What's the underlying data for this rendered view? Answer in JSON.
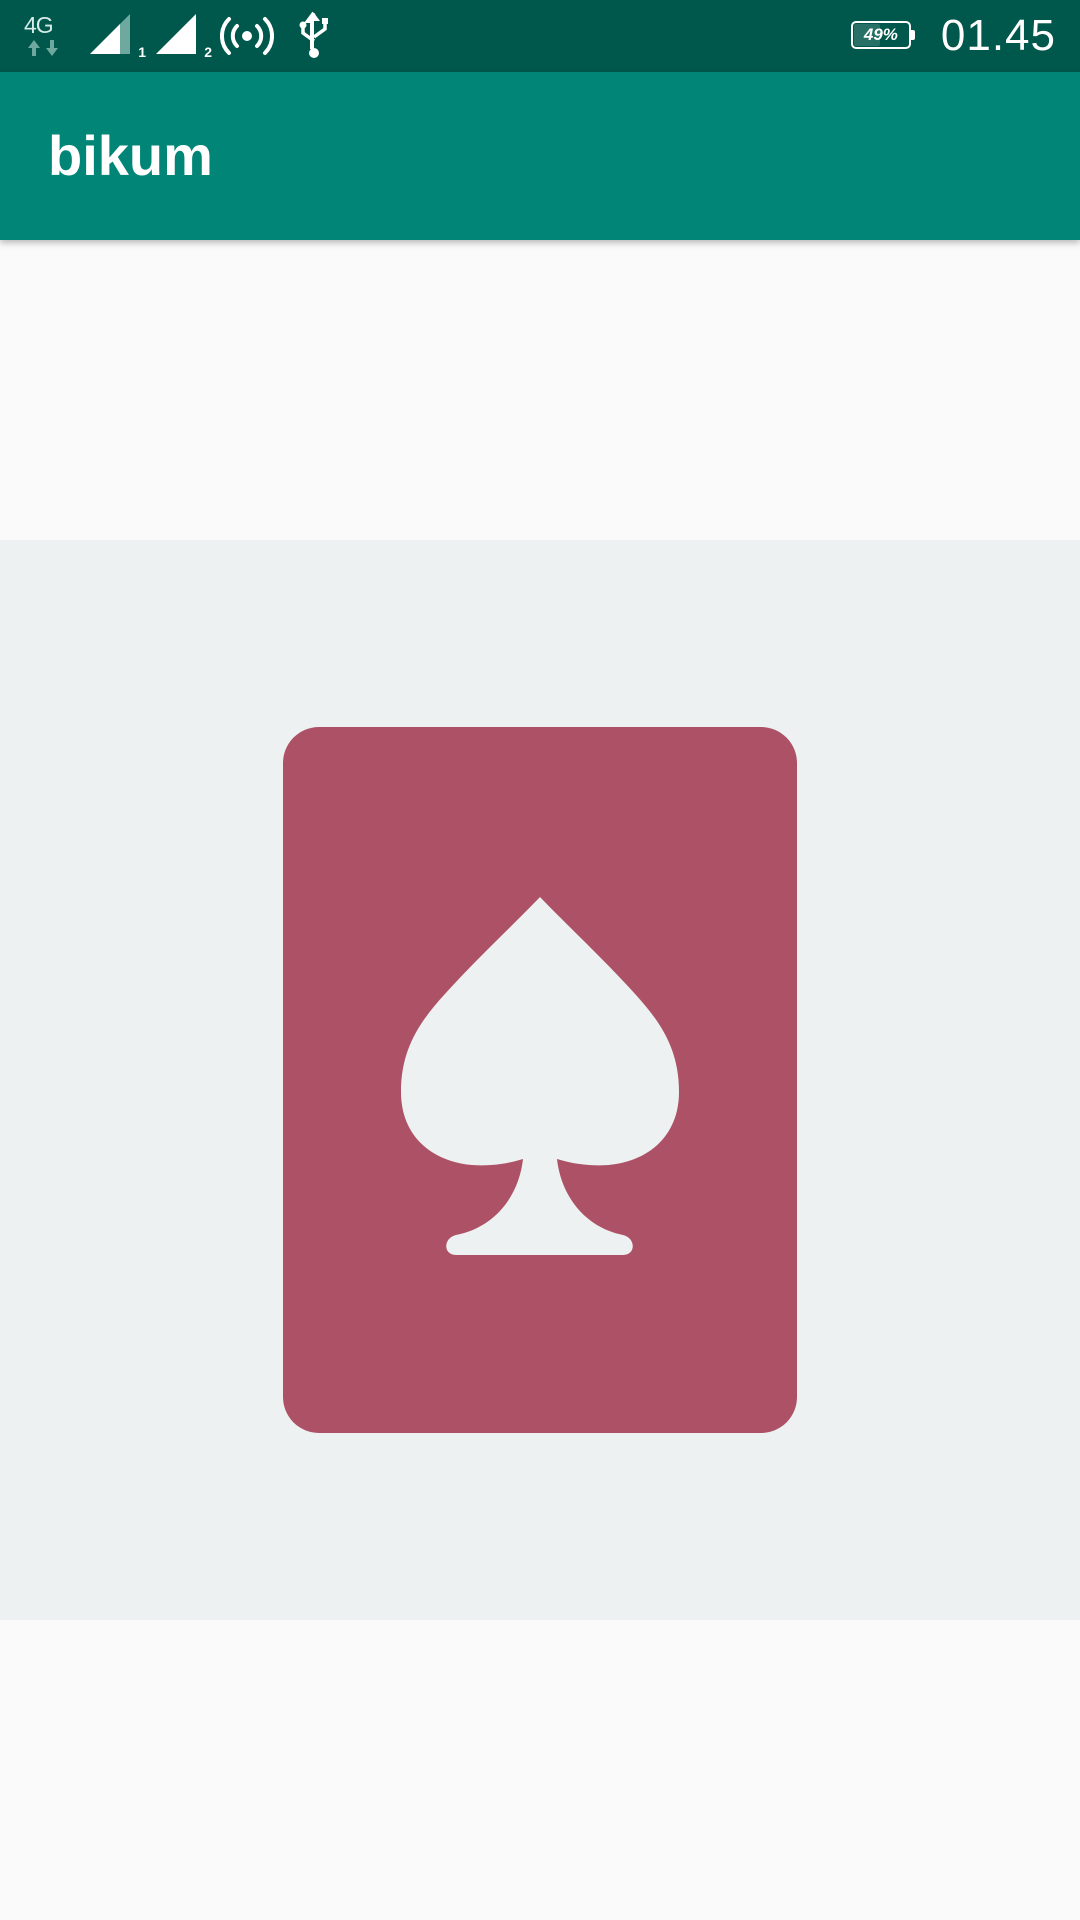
{
  "status_bar": {
    "network_type": "4G",
    "sim1_label": "1",
    "sim2_label": "2",
    "battery_percent": "49%",
    "battery_level": 0.49,
    "time": "01.45",
    "icons": [
      "4g-data-icon",
      "signal-strength-icon",
      "signal-strength-icon",
      "hotspot-icon",
      "usb-icon",
      "battery-icon"
    ]
  },
  "app_bar": {
    "title": "bikum"
  },
  "card": {
    "suit_icon": "spade-icon",
    "colors": {
      "card": "#ad5266",
      "suit": "#eef1f1",
      "panel": "#eef1f1"
    }
  },
  "colors": {
    "status_bar": "#00574b",
    "app_bar": "#008577",
    "background": "#fafafa"
  }
}
